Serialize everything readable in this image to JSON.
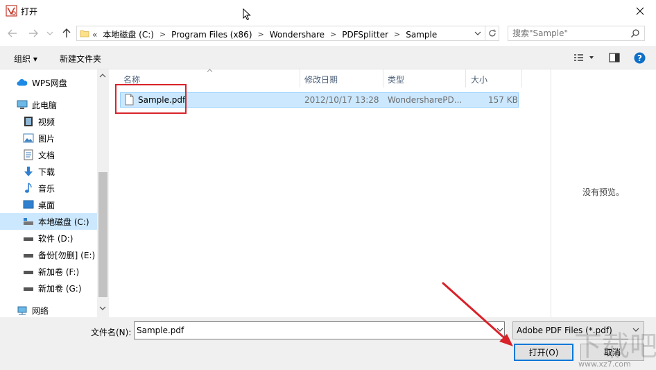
{
  "window": {
    "title": "打开"
  },
  "address": {
    "prefix": "«",
    "crumbs": [
      "本地磁盘 (C:)",
      "Program Files (x86)",
      "Wondershare",
      "PDFSplitter",
      "Sample"
    ]
  },
  "search": {
    "placeholder": "搜索\"Sample\""
  },
  "toolbar": {
    "organize_label": "组织 ▾",
    "new_folder_label": "新建文件夹"
  },
  "sidebar": {
    "items": [
      {
        "label": "WPS网盘",
        "icon": "cloud-icon"
      },
      {
        "label": "此电脑",
        "icon": "computer-icon"
      },
      {
        "label": "视频",
        "icon": "video-icon"
      },
      {
        "label": "图片",
        "icon": "picture-icon"
      },
      {
        "label": "文档",
        "icon": "document-icon"
      },
      {
        "label": "下载",
        "icon": "download-icon"
      },
      {
        "label": "音乐",
        "icon": "music-icon"
      },
      {
        "label": "桌面",
        "icon": "desktop-icon"
      },
      {
        "label": "本地磁盘 (C:)",
        "icon": "drive-icon",
        "selected": true
      },
      {
        "label": "软件 (D:)",
        "icon": "drive-icon"
      },
      {
        "label": "备份[勿删] (E:)",
        "icon": "drive-icon"
      },
      {
        "label": "新加卷 (F:)",
        "icon": "drive-icon"
      },
      {
        "label": "新加卷 (G:)",
        "icon": "drive-icon"
      },
      {
        "label": "网络",
        "icon": "network-icon"
      }
    ]
  },
  "columns": {
    "name": "名称",
    "date": "修改日期",
    "type": "类型",
    "size": "大小"
  },
  "files": [
    {
      "name": "Sample.pdf",
      "date": "2012/10/17 13:28",
      "type": "WondersharePD...",
      "size": "157 KB"
    }
  ],
  "preview": {
    "empty_text": "没有预览。"
  },
  "bottom": {
    "filename_label": "文件名(N):",
    "filename_value": "Sample.pdf",
    "filter_value": "Adobe PDF Files (*.pdf)",
    "open_label": "打开(O)",
    "cancel_label": "取消"
  },
  "watermark": {
    "text": "www.xz7.com"
  },
  "colors": {
    "accent": "#0078d7",
    "selection": "#cce8ff",
    "annotation": "#d9222a"
  }
}
